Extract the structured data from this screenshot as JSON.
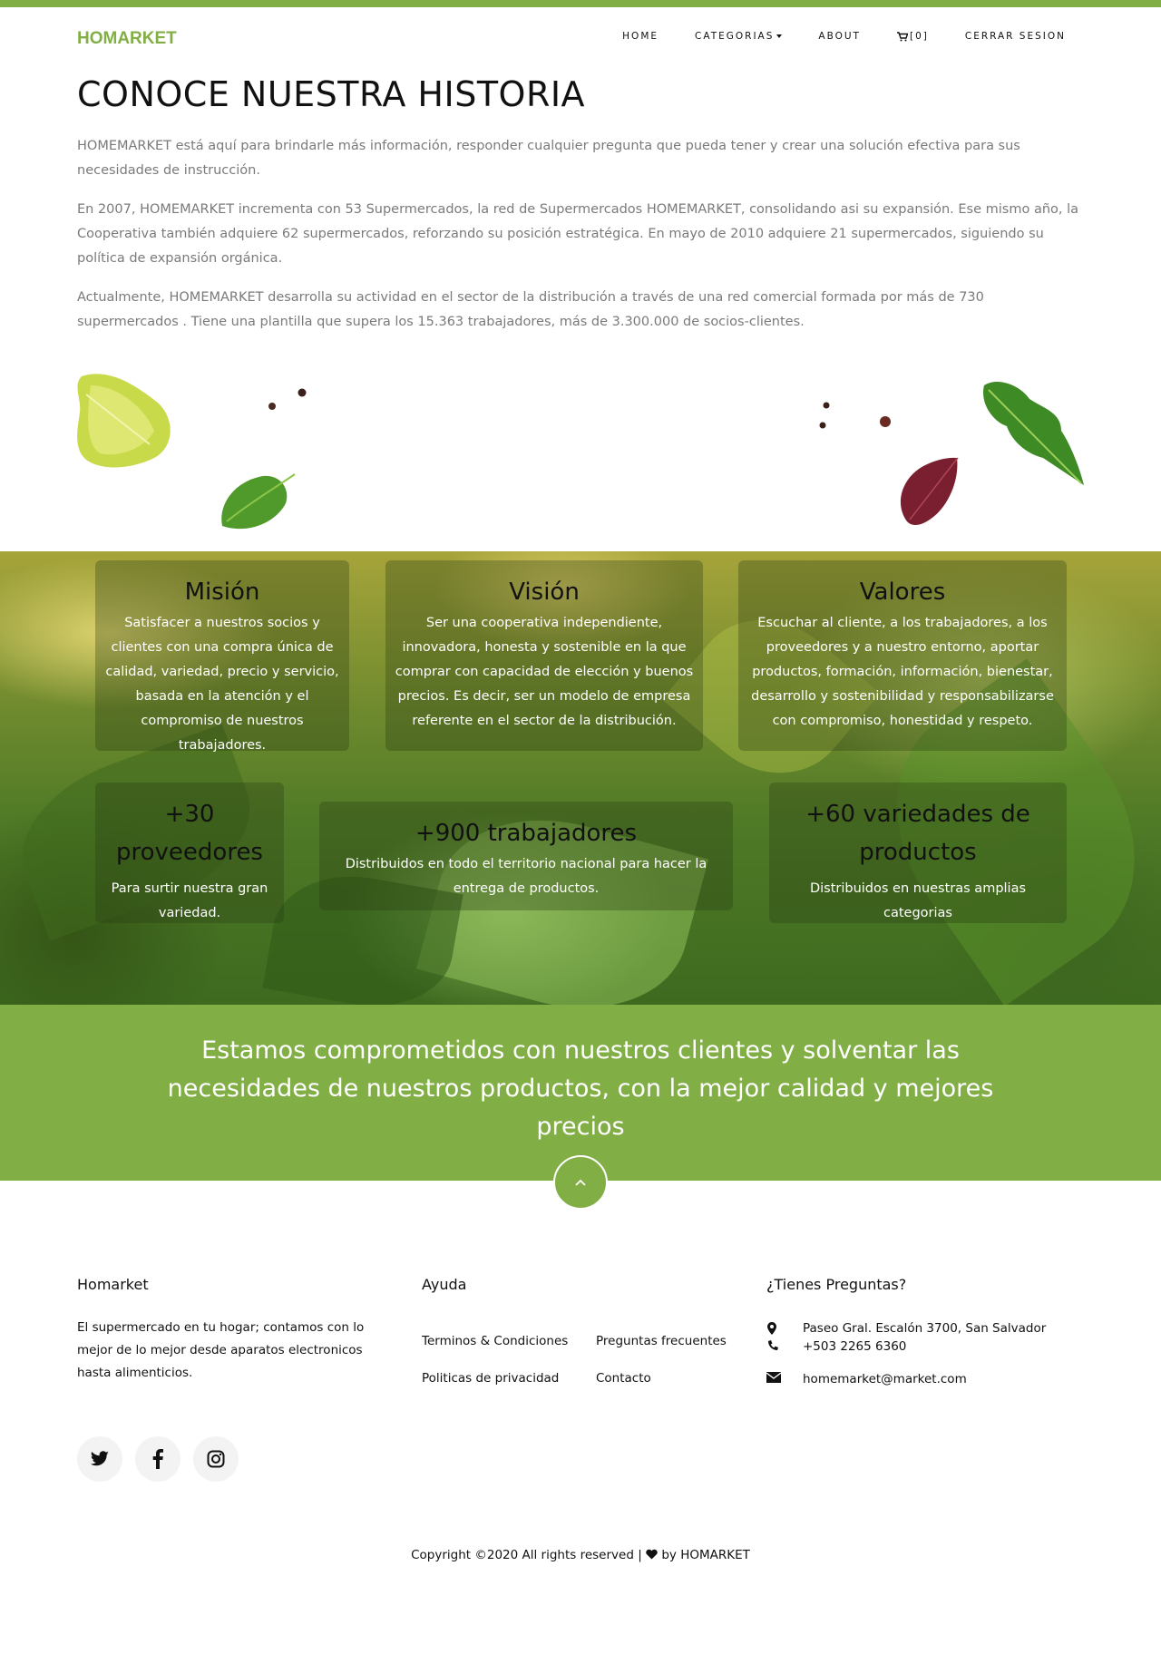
{
  "nav": {
    "brand": "HOMARKET",
    "items": [
      {
        "label": "HOME"
      },
      {
        "label": "CATEGORIAS"
      },
      {
        "label": "ABOUT"
      },
      {
        "label": "[0]"
      },
      {
        "label": "CERRAR SESION"
      }
    ]
  },
  "history": {
    "title": "CONOCE NUESTRA HISTORIA",
    "paragraphs": [
      "HOMEMARKET está aquí para brindarle más información, responder cualquier pregunta que pueda tener y crear una solución efectiva para sus necesidades de instrucción.",
      "En 2007, HOMEMARKET incrementa con 53 Supermercados, la red de Supermercados HOMEMARKET, consolidando asi su expansión. Ese mismo año, la Cooperativa también adquiere 62 supermercados, reforzando su posición estratégica. En mayo de 2010 adquiere 21 supermercados, siguiendo su política de expansión orgánica.",
      "Actualmente, HOMEMARKET desarrolla su actividad en el sector de la distribución a través de una red comercial formada por más de 730 supermercados . Tiene una plantilla que supera los 15.363 trabajadores, más de 3.300.000 de socios-clientes."
    ]
  },
  "cards": {
    "mision": {
      "title": "Misión",
      "text": "Satisfacer a nuestros socios y clientes con una compra única de calidad, variedad, precio y servicio, basada en la atención y el compromiso de nuestros trabajadores."
    },
    "vision": {
      "title": "Visión",
      "text": "Ser una cooperativa independiente, innovadora, honesta y sostenible en la que comprar con capacidad de elección y buenos precios. Es decir, ser un modelo de empresa referente en el sector de la distribución."
    },
    "valores": {
      "title": "Valores",
      "text": "Escuchar al cliente, a los trabajadores, a los proveedores y a nuestro entorno, aportar productos, formación, información, bienestar, desarrollo y sostenibilidad y responsabilizarse con compromiso, honestidad y respeto."
    },
    "proveedores": {
      "title": "+30 proveedores",
      "text": "Para surtir nuestra gran variedad."
    },
    "trabajadores": {
      "title": "+900 trabajadores",
      "text": "Distribuidos en todo el territorio nacional para hacer la entrega de productos."
    },
    "variedades": {
      "title": "+60 variedades de productos",
      "text": "Distribuidos en nuestras amplias categorias"
    }
  },
  "commitment": "Estamos comprometidos con nuestros clientes y solventar las necesidades de nuestros productos, con la mejor calidad y mejores precios",
  "footer": {
    "about": {
      "title": "Homarket",
      "text": "El supermercado en tu hogar; contamos con lo mejor de lo mejor desde aparatos electronicos hasta alimenticios."
    },
    "help": {
      "title": "Ayuda",
      "links": [
        "Terminos & Condiciones",
        "Preguntas frecuentes",
        "Politicas de privacidad",
        "Contacto"
      ]
    },
    "contact": {
      "title": "¿Tienes Preguntas?",
      "address": "Paseo Gral. Escalón 3700, San Salvador",
      "phone": "+503 2265 6360",
      "email": "homemarket@market.com"
    },
    "social": [
      "twitter-icon",
      "facebook-icon",
      "instagram-icon"
    ],
    "copyright_prefix": "Copyright ©2020 All rights reserved |",
    "copyright_suffix": "by HOMARKET"
  },
  "colors": {
    "accent": "#82ae46"
  }
}
